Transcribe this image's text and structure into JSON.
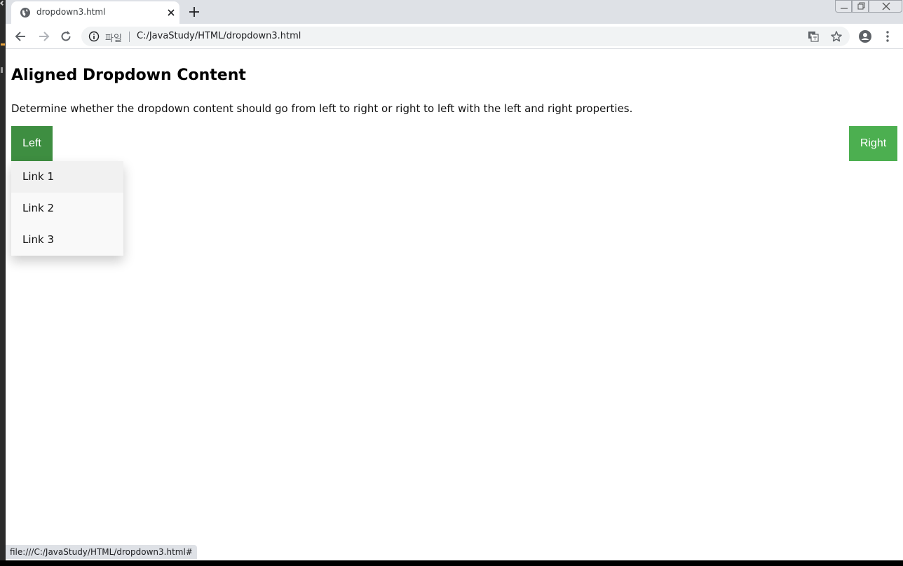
{
  "tab": {
    "title": "dropdown3.html"
  },
  "address_bar": {
    "scheme_label": "파일",
    "url": "C:/JavaStudy/HTML/dropdown3.html"
  },
  "page": {
    "heading": "Aligned Dropdown Content",
    "description": "Determine whether the dropdown content should go from left to right or right to left with the left and right properties.",
    "left_button": "Left",
    "right_button": "Right",
    "dropdown_links": [
      "Link 1",
      "Link 2",
      "Link 3"
    ]
  },
  "status_bar": {
    "text": "file:///C:/JavaStudy/HTML/dropdown3.html#"
  },
  "colors": {
    "button": "#4caf50",
    "button_active": "#3e8e41",
    "dropdown_bg": "#f9f9f9",
    "dropdown_hover": "#f1f1f1"
  },
  "icons": [
    "globe-icon",
    "close-icon",
    "plus-icon",
    "back-icon",
    "forward-icon",
    "reload-icon",
    "info-icon",
    "translate-icon",
    "star-icon",
    "account-icon",
    "menu-icon"
  ]
}
